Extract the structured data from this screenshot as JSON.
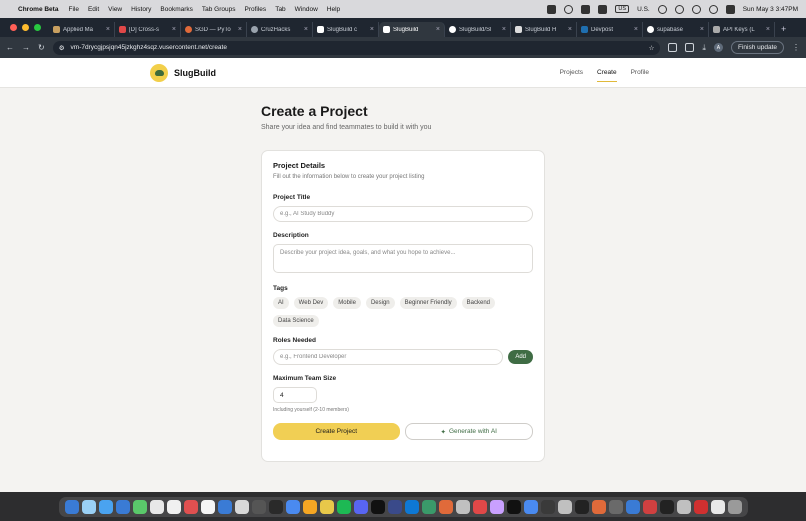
{
  "menubar": {
    "app": "Chrome Beta",
    "items": [
      "File",
      "Edit",
      "View",
      "History",
      "Bookmarks",
      "Tab Groups",
      "Profiles",
      "Tab",
      "Window",
      "Help"
    ],
    "input_source": "US",
    "input_source_label": "U.S.",
    "clock": "Sun May 3  3:47PM"
  },
  "browser": {
    "tabs": [
      {
        "title": "Applied Ma",
        "active": false
      },
      {
        "title": "[D] Cross-s",
        "active": false
      },
      {
        "title": "SGD — PyTo",
        "active": false
      },
      {
        "title": "CruzHacks",
        "active": false
      },
      {
        "title": "SlugBuild c",
        "active": false
      },
      {
        "title": "SlugBuild",
        "active": true
      },
      {
        "title": "SlugBuild/Sl",
        "active": false
      },
      {
        "title": "SlugBuild H",
        "active": false
      },
      {
        "title": "Devpost",
        "active": false
      },
      {
        "title": "supabase",
        "active": false
      },
      {
        "title": "API Keys (L",
        "active": false
      }
    ],
    "url": "vm-7drycgjpsjqn45jzkghz4sqz.vusercontent.net/create",
    "finish_update": "Finish update",
    "profile_initial": "A"
  },
  "site": {
    "brand": "SlugBuild",
    "nav": [
      {
        "label": "Projects",
        "active": false
      },
      {
        "label": "Create",
        "active": true
      },
      {
        "label": "Profile",
        "active": false
      }
    ]
  },
  "page": {
    "title": "Create a Project",
    "subtitle": "Share your idea and find teammates to build it with you"
  },
  "form": {
    "heading": "Project Details",
    "description": "Fill out the information below to create your project listing",
    "title_label": "Project Title",
    "title_placeholder": "e.g., AI Study Buddy",
    "desc_label": "Description",
    "desc_placeholder": "Describe your project idea, goals, and what you hope to achieve...",
    "tags_label": "Tags",
    "tags": [
      "AI",
      "Web Dev",
      "Mobile",
      "Design",
      "Beginner Friendly",
      "Backend",
      "Data Science"
    ],
    "roles_label": "Roles Needed",
    "roles_placeholder": "e.g., Frontend Developer",
    "add_label": "Add",
    "size_label": "Maximum Team Size",
    "size_value": "4",
    "size_hint": "Including yourself (2-10 members)",
    "create_label": "Create Project",
    "ai_label": "Generate with AI"
  },
  "dock": {
    "icon_colors": [
      "#3a7bd5",
      "#9ad0f5",
      "#4aa3f0",
      "#3a7bd5",
      "#5ac86a",
      "#e8e8e8",
      "#f0f0f0",
      "#e05050",
      "#f5f5f5",
      "#3a7bd5",
      "#d8d8d8",
      "#555555",
      "#2a2a2a",
      "#4a8af0",
      "#f5a623",
      "#e8c84a",
      "#1db954",
      "#5865f2",
      "#111111",
      "#3a4a8a",
      "#0e78d4",
      "#3a9a6a",
      "#e06a3a",
      "#c0c0c0",
      "#e04848",
      "#c9a0ff",
      "#111111",
      "#4a8af0",
      "#3a3a3a",
      "#c0c0c0",
      "#222222",
      "#e06a3a",
      "#6a6a6a",
      "#3a7bd5",
      "#d04040",
      "#222222",
      "#c0c0c0",
      "#d03030",
      "#e8e8e8",
      "#9a9a9a"
    ]
  },
  "colors": {
    "accent_yellow": "#f1cf54",
    "accent_green": "#3f6c44",
    "page_bg": "#f4f3f1"
  }
}
